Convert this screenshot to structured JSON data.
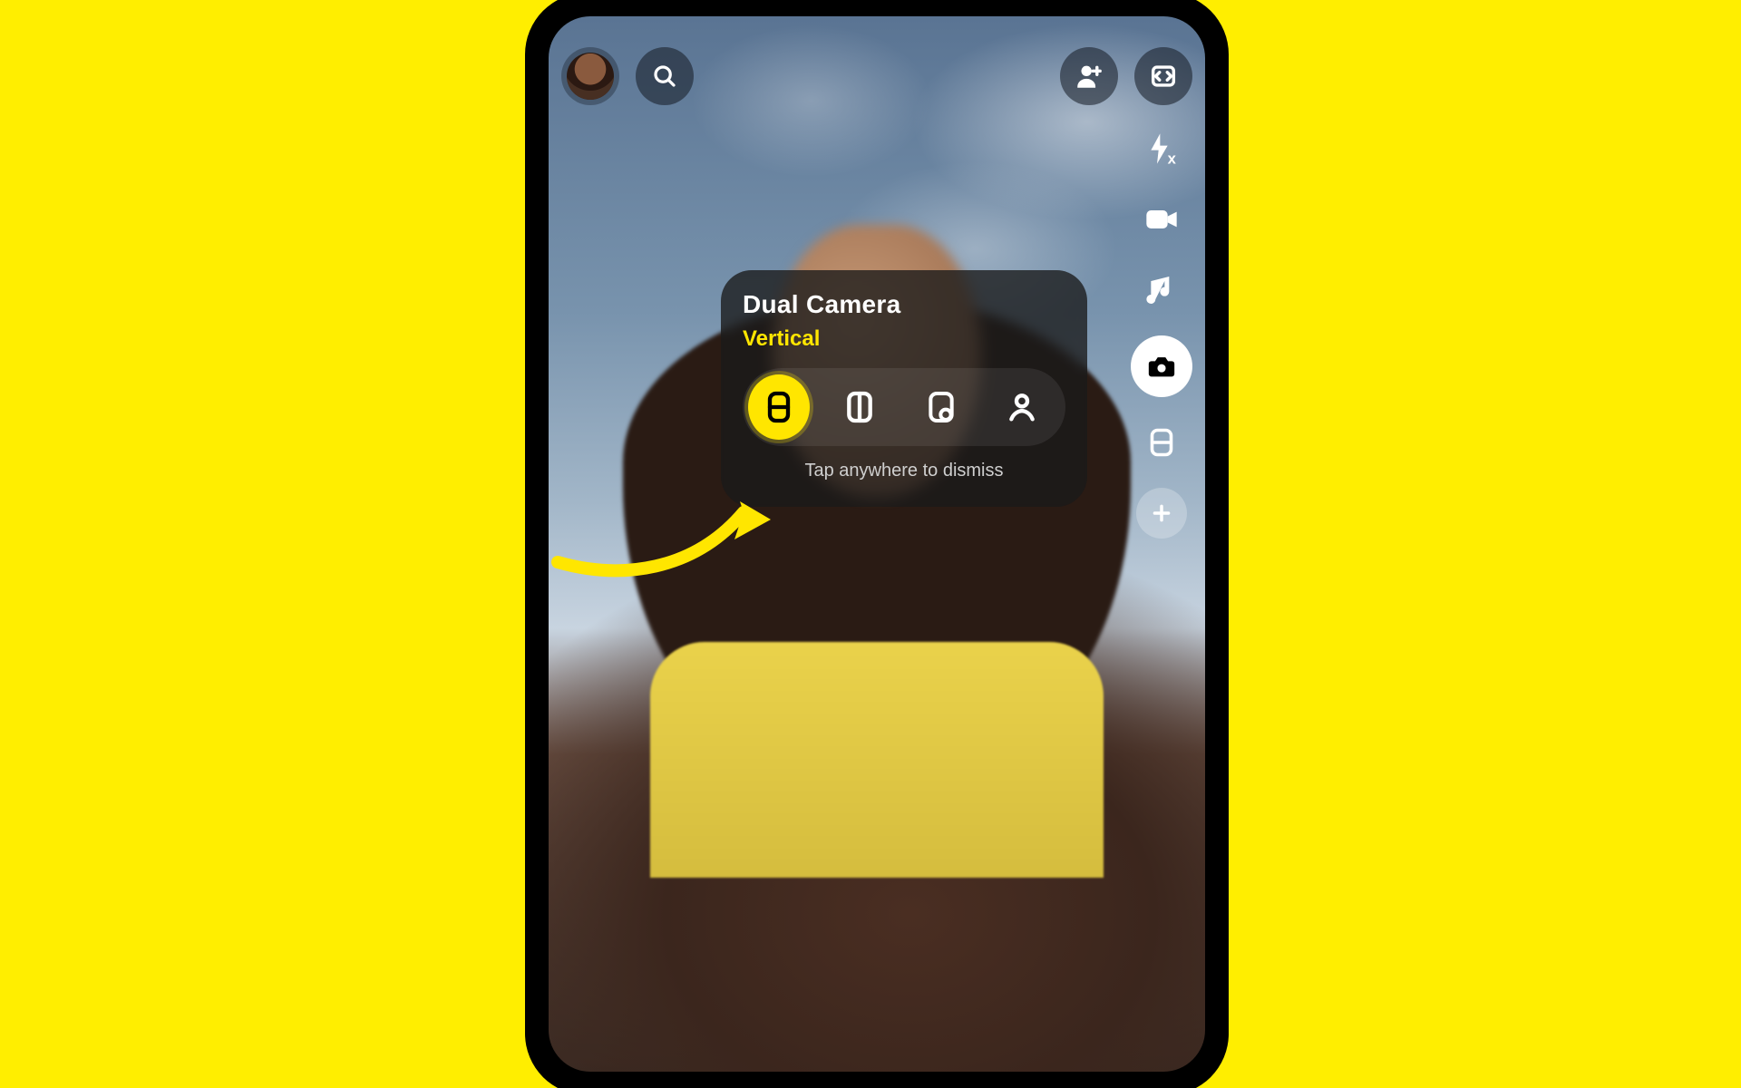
{
  "colors": {
    "brand_yellow": "#ffee00",
    "accent_yellow": "#ffe600"
  },
  "topbar": {
    "avatar_name": "avatar",
    "search_name": "search",
    "add_friend_name": "add-friend",
    "flip_name": "flip-camera"
  },
  "rail": {
    "items": [
      {
        "id": "flash",
        "label": "Flash off"
      },
      {
        "id": "video",
        "label": "Add video"
      },
      {
        "id": "music",
        "label": "Music"
      },
      {
        "id": "camera",
        "label": "Camera options",
        "selected": true
      },
      {
        "id": "dual",
        "label": "Dual layout"
      },
      {
        "id": "add",
        "label": "Add tool"
      }
    ]
  },
  "tooltip": {
    "title": "Dual Camera",
    "selected_label": "Vertical",
    "dismiss": "Tap anywhere to dismiss",
    "options": [
      {
        "id": "vertical",
        "selected": true,
        "icon": "split-horizontal-icon"
      },
      {
        "id": "horizontal",
        "selected": false,
        "icon": "split-vertical-icon"
      },
      {
        "id": "pip",
        "selected": false,
        "icon": "pip-icon"
      },
      {
        "id": "cutout",
        "selected": false,
        "icon": "person-icon"
      }
    ]
  }
}
